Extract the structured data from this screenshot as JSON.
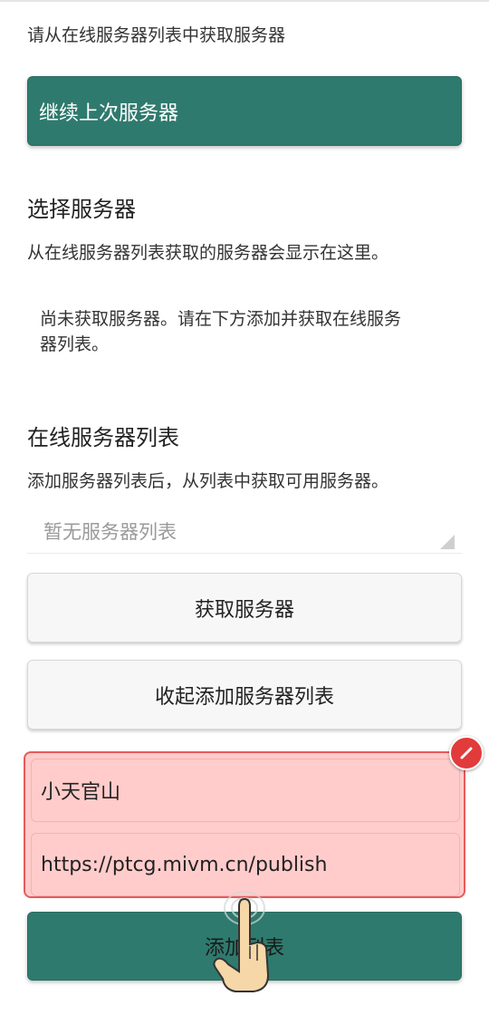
{
  "prompt_text": "请从在线服务器列表中获取服务器",
  "continue_button": "继续上次服务器",
  "select_server": {
    "title": "选择服务器",
    "description": "从在线服务器列表获取的服务器会显示在这里。",
    "empty_line1": "尚未获取服务器。请在下方添加并获取在线服务",
    "empty_line2": "器列表。"
  },
  "online_list": {
    "title": "在线服务器列表",
    "description": "添加服务器列表后，从列表中获取可用服务器。",
    "dropdown_placeholder": "暂无服务器列表",
    "fetch_button": "获取服务器",
    "collapse_button": "收起添加服务器列表",
    "name_value": "小天官山",
    "url_value": "https://ptcg.mivm.cn/publish",
    "add_button": "添加列表"
  },
  "icons": {
    "edit_badge": "edit-icon",
    "tap_hand": "pointing-hand-icon"
  },
  "colors": {
    "primary": "#2f7a6e",
    "highlight_fill": "#ffcccb",
    "highlight_border": "#e85a5a"
  }
}
